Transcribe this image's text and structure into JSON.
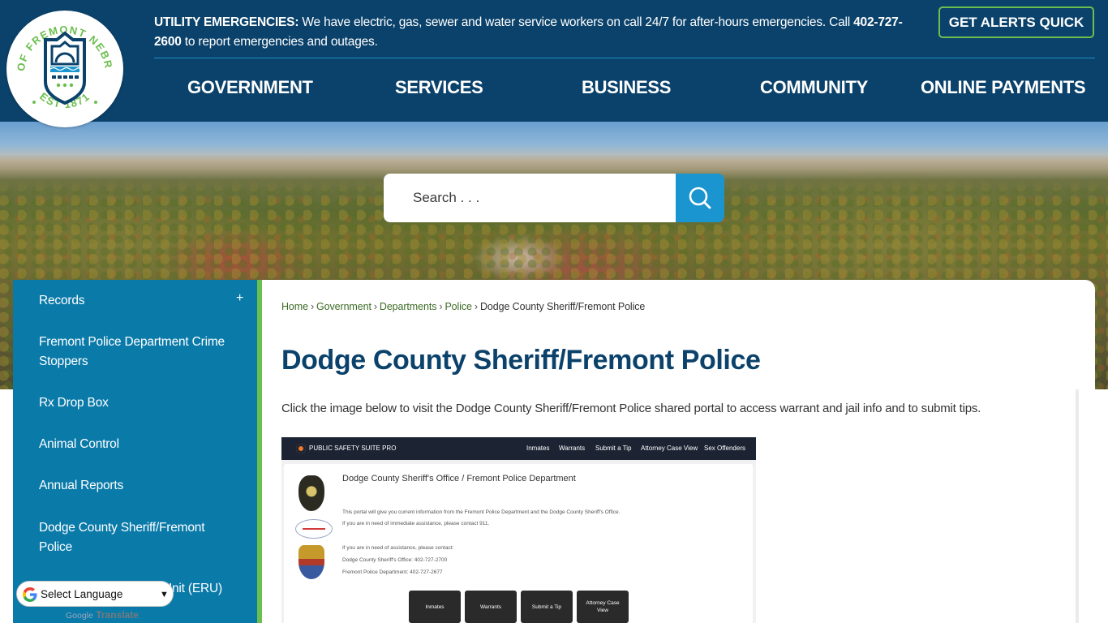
{
  "header": {
    "logo": {
      "alt": "City of Fremont Nebraska seal",
      "ring_text_top": "CITY OF FREMONT NEBRASKA",
      "ring_text_bottom": "EST 1871"
    },
    "alert": {
      "label": "UTILITY EMERGENCIES:",
      "text_before_phone": " We have electric, gas, sewer and water service workers on call 24/7 for after-hours emergencies. Call ",
      "phone": "402-727-2600",
      "text_after_phone": " to report emergencies and outages."
    },
    "alerts_button": "GET ALERTS QUICK",
    "nav": [
      {
        "label": "GOVERNMENT"
      },
      {
        "label": "SERVICES"
      },
      {
        "label": "BUSINESS"
      },
      {
        "label": "COMMUNITY"
      },
      {
        "label": "ONLINE PAYMENTS"
      }
    ]
  },
  "search": {
    "placeholder": "Search . . .",
    "button_icon": "search-icon"
  },
  "sidebar": {
    "items": [
      {
        "label": "Records",
        "expandable": true,
        "expand_glyph": "+"
      },
      {
        "label": "Fremont Police Department Crime Stoppers"
      },
      {
        "label": "Rx Drop Box"
      },
      {
        "label": "Animal Control"
      },
      {
        "label": "Annual Reports"
      },
      {
        "label": "Dodge County Sheriff/Fremont Police"
      },
      {
        "label": "Emergency Response Unit (ERU)"
      }
    ]
  },
  "breadcrumb": {
    "items": [
      "Home",
      "Government",
      "Departments",
      "Police"
    ],
    "current": "Dodge County Sheriff/Fremont Police",
    "separator": "›"
  },
  "main": {
    "title": "Dodge County Sheriff/Fremont Police",
    "intro": "Click the image below to visit the Dodge County Sheriff/Fremont Police shared portal to access warrant and jail info and to submit tips."
  },
  "portal_image": {
    "brand": "PUBLIC SAFETY SUITE PRO",
    "nav": [
      "Inmates",
      "Warrants",
      "Submit a Tip",
      "Attorney Case View",
      "Sex Offenders"
    ],
    "heading": "Dodge County Sheriff's Office / Fremont Police Department",
    "lines": [
      "This portal will give you current information from the Fremont Police Department and the Dodge County Sheriff's Office.",
      "If you are in need of immediate assistance, please contact 911.",
      "If you are in need of assistance, please contact:",
      "Dodge County Sheriff's Office:  402-727-2700",
      "Fremont Police Department:  402-727-2677"
    ],
    "buttons": [
      "Inmates",
      "Warrants",
      "Submit a Tip",
      "Attorney Case View"
    ]
  },
  "translate": {
    "select_label": "Select Language",
    "powered_brand": "Google",
    "powered_label": "Translate"
  },
  "colors": {
    "header_bg": "#0b426b",
    "accent_green": "#6bbf4e",
    "sidebar_bg": "#0a7aa9",
    "search_button": "#1b95cf",
    "title": "#0b426b",
    "breadcrumb_link": "#3d6b25"
  }
}
